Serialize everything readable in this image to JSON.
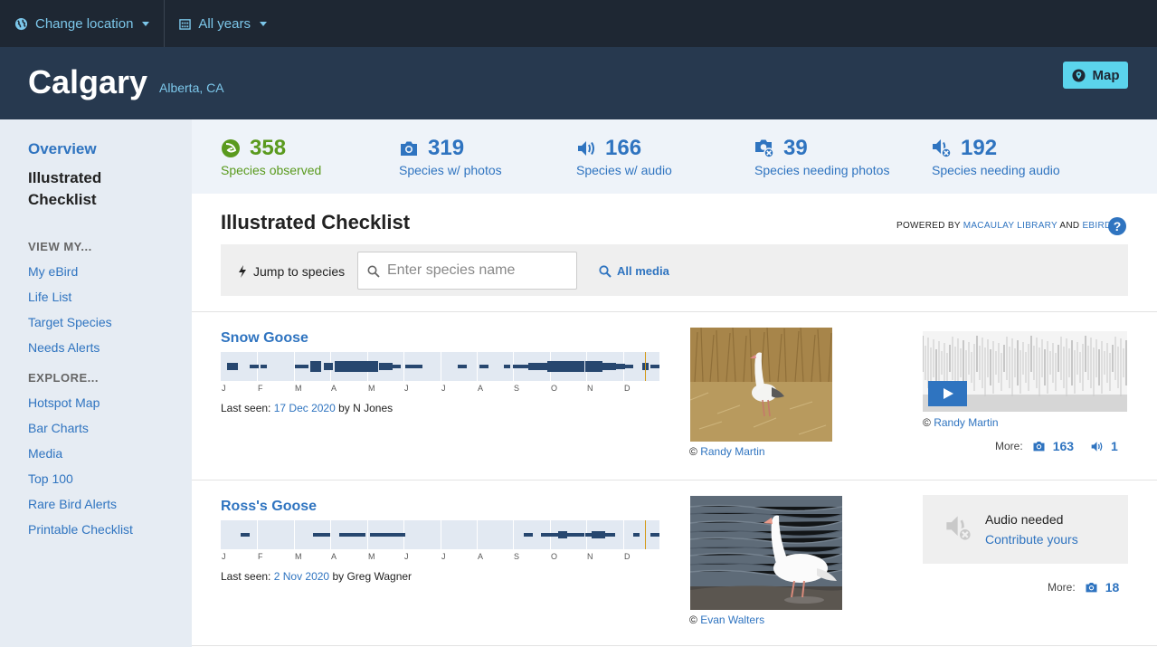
{
  "topbar": {
    "location_label": "Change location",
    "years_label": "All years"
  },
  "header": {
    "city": "Calgary",
    "region": "Alberta, CA",
    "map_button": "Map"
  },
  "sidebar": {
    "overview": "Overview",
    "current": "Illustrated Checklist",
    "view_heading": "VIEW MY...",
    "view_items": [
      "My eBird",
      "Life List",
      "Target Species",
      "Needs Alerts"
    ],
    "explore_heading": "EXPLORE...",
    "explore_items": [
      "Hotspot Map",
      "Bar Charts",
      "Media",
      "Top 100",
      "Rare Bird Alerts",
      "Printable Checklist"
    ]
  },
  "stats": [
    {
      "value": "358",
      "label": "Species observed",
      "icon": "leaf-icon",
      "color": "#5a9a1e"
    },
    {
      "value": "319",
      "label": "Species w/ photos",
      "icon": "camera-icon",
      "color": "#2f74c0"
    },
    {
      "value": "166",
      "label": "Species w/ audio",
      "icon": "speaker-icon",
      "color": "#2f74c0"
    },
    {
      "value": "39",
      "label": "Species needing photos",
      "icon": "camera-needed-icon",
      "color": "#2f74c0"
    },
    {
      "value": "192",
      "label": "Species needing audio",
      "icon": "speaker-needed-icon",
      "color": "#2f74c0"
    }
  ],
  "checklist": {
    "title": "Illustrated Checklist",
    "powered_prefix": "POWERED BY",
    "powered_link1": "MACAULAY LIBRARY",
    "powered_and": "AND",
    "powered_link2": "EBIRD",
    "help": "?",
    "jump_label": "Jump to species",
    "search_placeholder": "Enter species name",
    "all_media": "All media",
    "months": [
      "J",
      "F",
      "M",
      "A",
      "M",
      "J",
      "J",
      "A",
      "S",
      "O",
      "N",
      "D"
    ]
  },
  "species": [
    {
      "name": "Snow Goose",
      "last_seen_prefix": "Last seen:",
      "last_seen_date": "17 Dec 2020",
      "last_seen_by": "by N Jones",
      "photo_credit_symbol": "©",
      "photo_credit": "Randy Martin",
      "audio_credit_symbol": "©",
      "audio_credit": "Randy Martin",
      "more_label": "More:",
      "more_photos": "163",
      "more_audio": "1"
    },
    {
      "name": "Ross's Goose",
      "last_seen_prefix": "Last seen:",
      "last_seen_date": "2 Nov 2020",
      "last_seen_by": "by Greg Wagner",
      "photo_credit_symbol": "©",
      "photo_credit": "Evan Walters",
      "audio_needed_title": "Audio needed",
      "audio_needed_link": "Contribute yours",
      "more_label": "More:",
      "more_photos": "18"
    }
  ],
  "colors": {
    "topbar": "#1e2733",
    "header": "#27394f",
    "accent": "#2f74c0",
    "accent_light": "#7cc7ea",
    "green": "#5a9a1e",
    "bar": "#27476f",
    "marker": "#d49a18"
  }
}
